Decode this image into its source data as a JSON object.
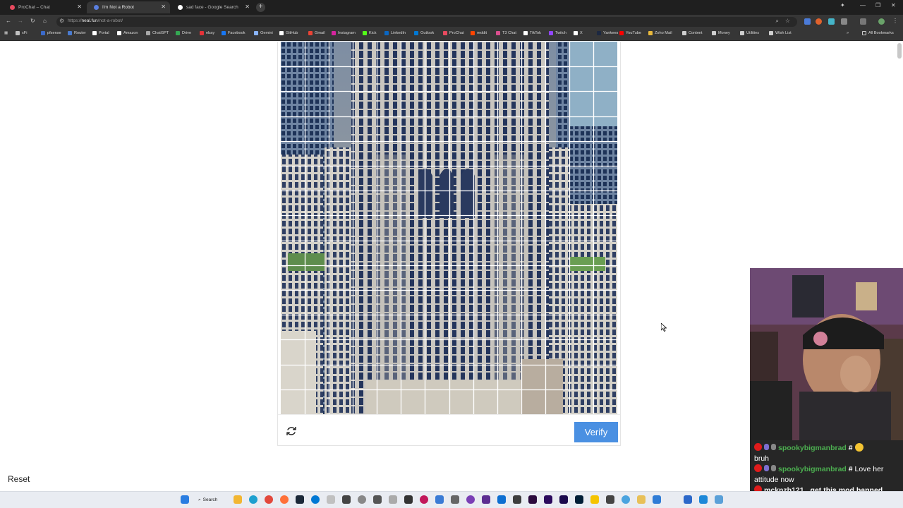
{
  "browser": {
    "tabs": [
      {
        "title": "ProChat – Chat",
        "active": false,
        "favicon_color": "#e84a5f"
      },
      {
        "title": "I'm Not a Robot",
        "active": true,
        "favicon_color": "#5a7fe0"
      },
      {
        "title": "sad face - Google Search",
        "active": false,
        "favicon_color": "#ffffff"
      }
    ],
    "new_tab": "+",
    "url_prefix": "https://",
    "url_host": "neal.fun",
    "url_path": "/not-a-robot/",
    "bookmarks": [
      {
        "label": "xFi",
        "color": "#c0c0c0"
      },
      {
        "label": "pfsense",
        "color": "#3b6ac9"
      },
      {
        "label": "Router",
        "color": "#4a7bd0"
      },
      {
        "label": "Portal",
        "color": "#ffffff"
      },
      {
        "label": "Amazon",
        "color": "#ffffff"
      },
      {
        "label": "ChatGPT",
        "color": "#a8a8a8"
      },
      {
        "label": "Drive",
        "color": "#34a853"
      },
      {
        "label": "ebay",
        "color": "#e53238"
      },
      {
        "label": "Facebook",
        "color": "#1877f2"
      },
      {
        "label": "Gemini",
        "color": "#8ab4f8"
      },
      {
        "label": "GitHub",
        "color": "#ffffff"
      },
      {
        "label": "Gmail",
        "color": "#ea4335"
      },
      {
        "label": "Instagram",
        "color": "#d6249f"
      },
      {
        "label": "Kick",
        "color": "#53fc18"
      },
      {
        "label": "LinkedIn",
        "color": "#0a66c2"
      },
      {
        "label": "Outlook",
        "color": "#0078d4"
      },
      {
        "label": "ProChat",
        "color": "#e84a5f"
      },
      {
        "label": "reddit",
        "color": "#ff4500"
      },
      {
        "label": "T3 Chat",
        "color": "#d94f8e"
      },
      {
        "label": "TikTok",
        "color": "#ffffff"
      },
      {
        "label": "Twitch",
        "color": "#9146ff"
      },
      {
        "label": "X",
        "color": "#ffffff"
      },
      {
        "label": "Yankees",
        "color": "#1c2841"
      },
      {
        "label": "YouTube",
        "color": "#ff0000"
      },
      {
        "label": "Zoho Mail",
        "color": "#e8b83c"
      },
      {
        "label": "Content",
        "color": "#cfcfcf"
      },
      {
        "label": "Money",
        "color": "#cfcfcf"
      },
      {
        "label": "Utilities",
        "color": "#cfcfcf"
      },
      {
        "label": "Wish List",
        "color": "#cfcfcf"
      }
    ],
    "all_bookmarks": "All Bookmarks"
  },
  "captcha": {
    "verify_label": "Verify",
    "reload_icon": "refresh-icon",
    "grid_columns": 14,
    "grid_rows": 15,
    "accent": "#4a90e2"
  },
  "page": {
    "reset_label": "Reset"
  },
  "chat": {
    "messages": [
      {
        "user": "spookybigmanbrad",
        "text": "bruh",
        "mod": false
      },
      {
        "user": "spookybigmanbrad",
        "text": "Love her attitude now",
        "mod": false
      },
      {
        "user": "mcknzb121",
        "text": "get this mod banned",
        "mod": true
      }
    ]
  },
  "taskbar": {
    "search_label": "Search"
  }
}
